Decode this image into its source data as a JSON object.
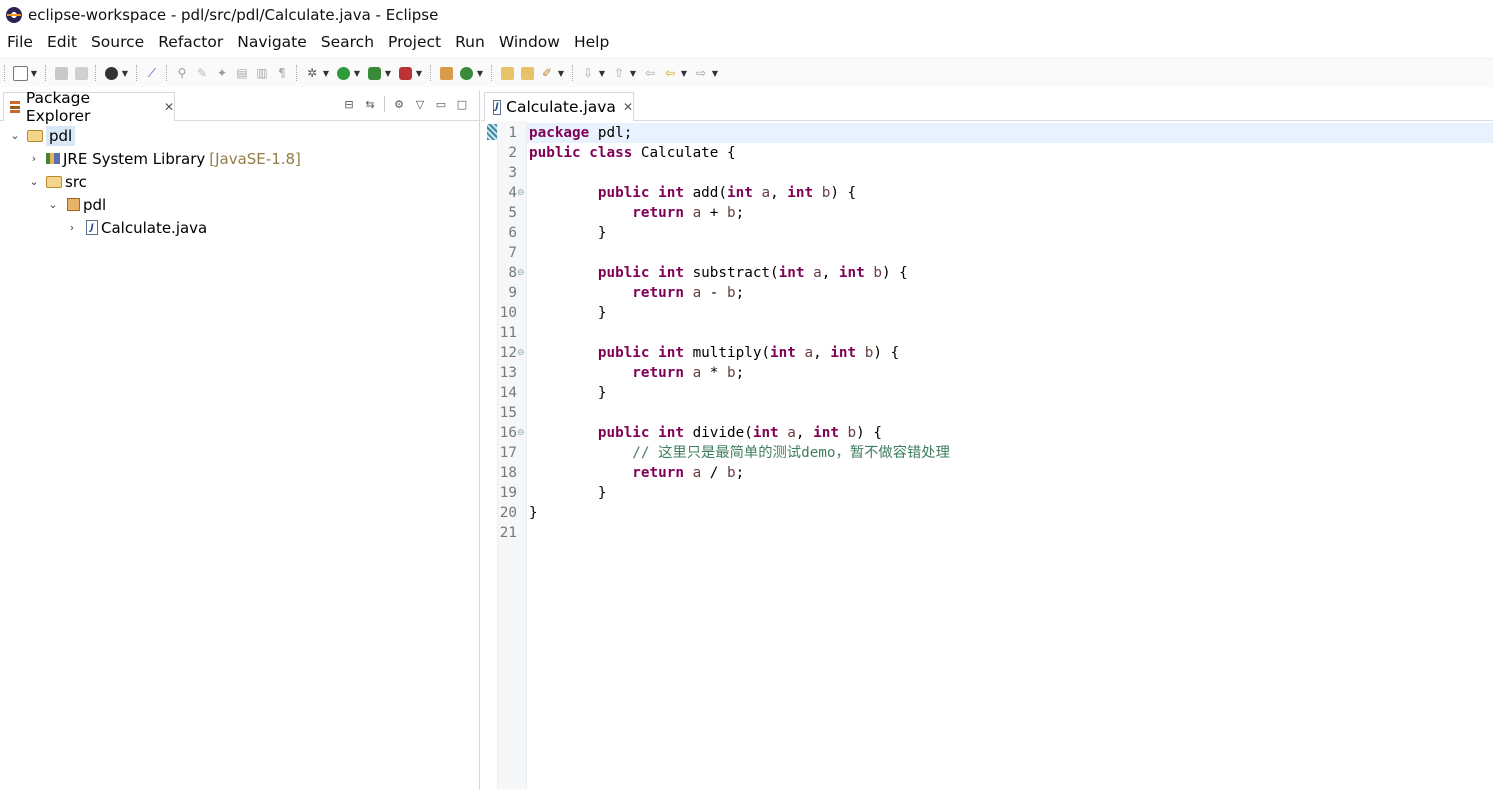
{
  "window": {
    "title": "eclipse-workspace - pdl/src/pdl/Calculate.java - Eclipse"
  },
  "menu": [
    {
      "label": "File"
    },
    {
      "label": "Edit"
    },
    {
      "label": "Source"
    },
    {
      "label": "Refactor"
    },
    {
      "label": "Navigate"
    },
    {
      "label": "Search"
    },
    {
      "label": "Project"
    },
    {
      "label": "Run"
    },
    {
      "label": "Window"
    },
    {
      "label": "Help"
    }
  ],
  "toolbar_icons": [
    "new-icon",
    "save-icon",
    "save-all-icon",
    "profile-icon",
    "skip-breakpoints-icon",
    "toggle-mark-icon",
    "edit-icon",
    "next-annotation-icon",
    "show-whitespace-icon",
    "block-selection-icon",
    "debug-icon",
    "run-icon",
    "coverage-icon",
    "external-tools-icon",
    "new-java-package-icon",
    "new-java-class-icon",
    "open-type-icon",
    "open-task-icon",
    "search-icon",
    "next-edit-icon",
    "prev-edit-icon",
    "back-icon",
    "forward-icon"
  ],
  "left_view": {
    "tab_label": "Package Explorer",
    "tree": [
      {
        "label": "pdl",
        "decor": "",
        "level": 0,
        "expanded": true,
        "selected": true,
        "icon": "project-icon"
      },
      {
        "label": "JRE System Library",
        "decor": "[JavaSE-1.8]",
        "level": 1,
        "expanded": false,
        "icon": "library-icon"
      },
      {
        "label": "src",
        "decor": "",
        "level": 1,
        "expanded": true,
        "icon": "source-folder-icon"
      },
      {
        "label": "pdl",
        "decor": "",
        "level": 2,
        "expanded": true,
        "icon": "package-icon"
      },
      {
        "label": "Calculate.java",
        "decor": "",
        "level": 3,
        "expanded": false,
        "icon": "java-file-icon"
      }
    ]
  },
  "editor": {
    "tab_label": "Calculate.java",
    "line_numbers": [
      "1",
      "2",
      "3",
      "4",
      "5",
      "6",
      "7",
      "8",
      "9",
      "10",
      "11",
      "12",
      "13",
      "14",
      "15",
      "16",
      "17",
      "18",
      "19",
      "20",
      "21"
    ],
    "fold_lines": [
      "4",
      "8",
      "12",
      "16"
    ],
    "lines": [
      [
        [
          "kw",
          "package"
        ],
        [
          "tx",
          " pdl;"
        ]
      ],
      [
        [
          "kw",
          "public"
        ],
        [
          "tx",
          " "
        ],
        [
          "kw",
          "class"
        ],
        [
          "tx",
          " Calculate {"
        ]
      ],
      [],
      [
        [
          "tx",
          "        "
        ],
        [
          "kw",
          "public"
        ],
        [
          "tx",
          " "
        ],
        [
          "kw",
          "int"
        ],
        [
          "tx",
          " add("
        ],
        [
          "kw",
          "int"
        ],
        [
          "tx",
          " "
        ],
        [
          "param",
          "a"
        ],
        [
          "tx",
          ", "
        ],
        [
          "kw",
          "int"
        ],
        [
          "tx",
          " "
        ],
        [
          "param",
          "b"
        ],
        [
          "tx",
          ") {"
        ]
      ],
      [
        [
          "tx",
          "            "
        ],
        [
          "kw",
          "return"
        ],
        [
          "tx",
          " "
        ],
        [
          "param",
          "a"
        ],
        [
          "tx",
          " + "
        ],
        [
          "param",
          "b"
        ],
        [
          "tx",
          ";"
        ]
      ],
      [
        [
          "tx",
          "        }"
        ]
      ],
      [],
      [
        [
          "tx",
          "        "
        ],
        [
          "kw",
          "public"
        ],
        [
          "tx",
          " "
        ],
        [
          "kw",
          "int"
        ],
        [
          "tx",
          " substract("
        ],
        [
          "kw",
          "int"
        ],
        [
          "tx",
          " "
        ],
        [
          "param",
          "a"
        ],
        [
          "tx",
          ", "
        ],
        [
          "kw",
          "int"
        ],
        [
          "tx",
          " "
        ],
        [
          "param",
          "b"
        ],
        [
          "tx",
          ") {"
        ]
      ],
      [
        [
          "tx",
          "            "
        ],
        [
          "kw",
          "return"
        ],
        [
          "tx",
          " "
        ],
        [
          "param",
          "a"
        ],
        [
          "tx",
          " - "
        ],
        [
          "param",
          "b"
        ],
        [
          "tx",
          ";"
        ]
      ],
      [
        [
          "tx",
          "        }"
        ]
      ],
      [],
      [
        [
          "tx",
          "        "
        ],
        [
          "kw",
          "public"
        ],
        [
          "tx",
          " "
        ],
        [
          "kw",
          "int"
        ],
        [
          "tx",
          " multiply("
        ],
        [
          "kw",
          "int"
        ],
        [
          "tx",
          " "
        ],
        [
          "param",
          "a"
        ],
        [
          "tx",
          ", "
        ],
        [
          "kw",
          "int"
        ],
        [
          "tx",
          " "
        ],
        [
          "param",
          "b"
        ],
        [
          "tx",
          ") {"
        ]
      ],
      [
        [
          "tx",
          "            "
        ],
        [
          "kw",
          "return"
        ],
        [
          "tx",
          " "
        ],
        [
          "param",
          "a"
        ],
        [
          "tx",
          " * "
        ],
        [
          "param",
          "b"
        ],
        [
          "tx",
          ";"
        ]
      ],
      [
        [
          "tx",
          "        }"
        ]
      ],
      [],
      [
        [
          "tx",
          "        "
        ],
        [
          "kw",
          "public"
        ],
        [
          "tx",
          " "
        ],
        [
          "kw",
          "int"
        ],
        [
          "tx",
          " divide("
        ],
        [
          "kw",
          "int"
        ],
        [
          "tx",
          " "
        ],
        [
          "param",
          "a"
        ],
        [
          "tx",
          ", "
        ],
        [
          "kw",
          "int"
        ],
        [
          "tx",
          " "
        ],
        [
          "param",
          "b"
        ],
        [
          "tx",
          ") {"
        ]
      ],
      [
        [
          "tx",
          "            "
        ],
        [
          "cm",
          "// 这里只是最简单的测试demo，暂不做容错处理"
        ]
      ],
      [
        [
          "tx",
          "            "
        ],
        [
          "kw",
          "return"
        ],
        [
          "tx",
          " "
        ],
        [
          "param",
          "a"
        ],
        [
          "tx",
          " / "
        ],
        [
          "param",
          "b"
        ],
        [
          "tx",
          ";"
        ]
      ],
      [
        [
          "tx",
          "        }"
        ]
      ],
      [
        [
          "tx",
          "}"
        ]
      ],
      []
    ]
  }
}
